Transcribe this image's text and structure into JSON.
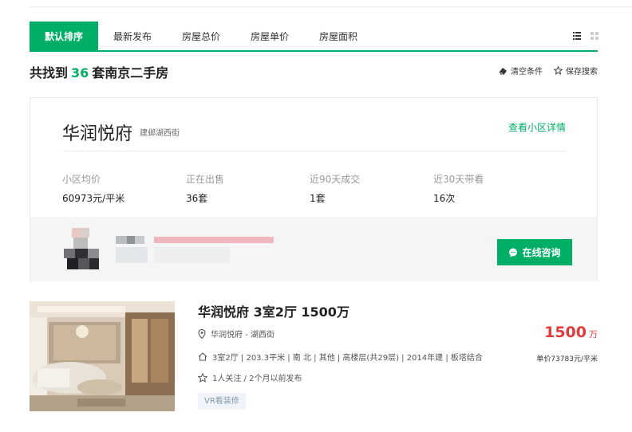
{
  "tabs": [
    {
      "label": "默认排序",
      "active": true
    },
    {
      "label": "最新发布",
      "active": false
    },
    {
      "label": "房屋总价",
      "active": false
    },
    {
      "label": "房屋单价",
      "active": false
    },
    {
      "label": "房屋面积",
      "active": false
    }
  ],
  "result": {
    "prefix": "共找到",
    "count": "36",
    "suffix": "套南京二手房"
  },
  "toolbar": {
    "clear": "清空条件",
    "save": "保存搜索"
  },
  "community": {
    "name": "华润悦府",
    "area": "建邺湖西街",
    "detail_link": "查看小区详情",
    "stats": [
      {
        "label": "小区均价",
        "value": "60973元/平米"
      },
      {
        "label": "正在出售",
        "value": "36套"
      },
      {
        "label": "近90天成交",
        "value": "1套"
      },
      {
        "label": "近30天带看",
        "value": "16次"
      }
    ],
    "consult_button": "在线咨询"
  },
  "listing": {
    "title": "华润悦府 3室2厅 1500万",
    "location": "华润悦府 - 湖西街",
    "info": "3室2厅 | 203.3平米 | 南 北 | 其他 | 高楼层(共29层) | 2014年建 | 板塔结合",
    "follow": "1人关注 / 2个月以前发布",
    "tag": "VR看装修",
    "price": "1500",
    "price_unit": "万",
    "unit_price": "单价73783元/平米"
  },
  "colors": {
    "accent": "#00ae66",
    "price": "#e4393c"
  }
}
